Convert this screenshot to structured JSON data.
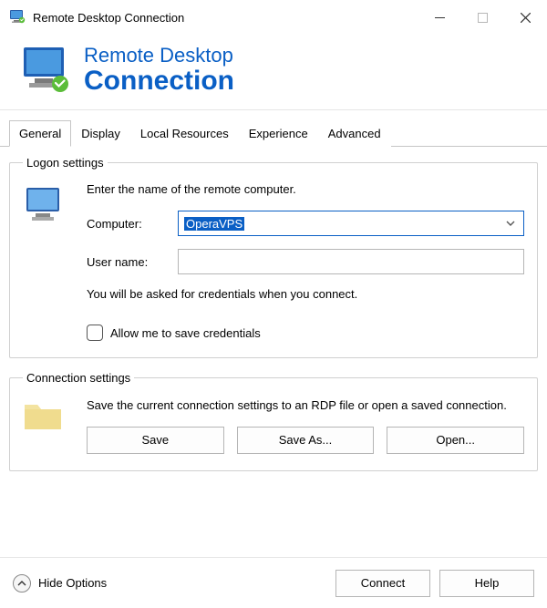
{
  "window": {
    "title": "Remote Desktop Connection"
  },
  "banner": {
    "line1": "Remote Desktop",
    "line2": "Connection"
  },
  "tabs": {
    "general": "General",
    "display": "Display",
    "local_resources": "Local Resources",
    "experience": "Experience",
    "advanced": "Advanced"
  },
  "logon": {
    "legend": "Logon settings",
    "intro": "Enter the name of the remote computer.",
    "computer_label": "Computer:",
    "computer_value": "OperaVPS",
    "username_label": "User name:",
    "username_value": "",
    "hint": "You will be asked for credentials when you connect.",
    "allow_save_label": "Allow me to save credentials",
    "allow_save_checked": false
  },
  "connection": {
    "legend": "Connection settings",
    "text": "Save the current connection settings to an RDP file or open a saved connection.",
    "save": "Save",
    "save_as": "Save As...",
    "open": "Open..."
  },
  "footer": {
    "options_toggle": "Hide Options",
    "connect": "Connect",
    "help": "Help"
  }
}
